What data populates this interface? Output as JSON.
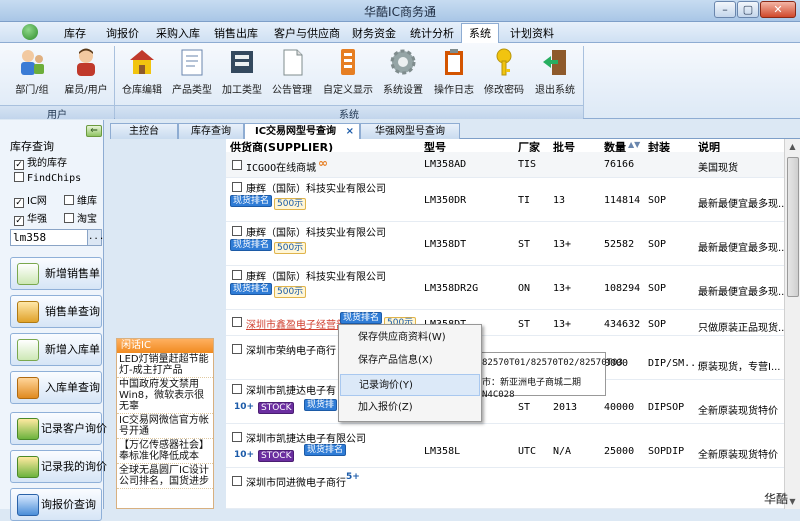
{
  "app": {
    "title": "华酷IC商务通"
  },
  "menu": {
    "items": [
      "库存",
      "询报价",
      "采购入库",
      "销售出库",
      "客户与供应商",
      "财务资金",
      "统计分析",
      "系统",
      "计划资料"
    ]
  },
  "ribbon": {
    "user_group": {
      "label": "用户",
      "buttons": [
        "部门/组",
        "雇员/用户"
      ]
    },
    "system_group": {
      "label": "系统",
      "buttons": [
        "仓库编辑",
        "产品类型",
        "加工类型",
        "公告管理",
        "自定义显示",
        "系统设置",
        "操作日志",
        "修改密码",
        "退出系统"
      ]
    }
  },
  "left_panel": {
    "title": "库存查询",
    "options": [
      {
        "label": "我的库存",
        "checked": true
      },
      {
        "label": "FindChips",
        "checked": false
      },
      {
        "label": "IC网",
        "checked": true
      },
      {
        "label": "维库",
        "checked": false
      },
      {
        "label": "华强",
        "checked": true
      },
      {
        "label": "淘宝",
        "checked": false
      }
    ],
    "search_value": "lm358",
    "search_btn": "...",
    "buttons": [
      "新增销售单",
      "销售单查询",
      "新增入库单",
      "入库单查询",
      "记录客户询价",
      "记录我的询价",
      "询报价查询"
    ]
  },
  "news": {
    "header": "闲话IC",
    "items": [
      "LED灯销量赶超节能灯-成主打产品",
      "中国政府发文禁用Win8，微软表示很无辜",
      "IC交易网微信官方帐号开通",
      "【万亿传感器社会】奉标准化降低成本",
      "全球无晶圆厂IC设计公司排名，国货进步"
    ]
  },
  "tabs": [
    "主控台",
    "库存查询",
    "IC交易网型号查询",
    "华强网型号查询"
  ],
  "tab_close": "×",
  "table": {
    "headers": [
      "供货商(SUPPLIER)",
      "型号",
      "厂家",
      "批号",
      "数量",
      "封装",
      "说明"
    ],
    "rows": [
      {
        "supplier": "ICGOO在线商城",
        "model": "LM358AD",
        "maker": "TIS",
        "batch": "",
        "qty": "76166",
        "pkg": "",
        "desc": "美国现货",
        "badges": []
      },
      {
        "supplier": "康辉（国际）科技实业有限公司",
        "model": "LM350DR",
        "maker": "TI",
        "batch": "13",
        "qty": "114814",
        "pkg": "SOP",
        "desc": "最新最便宜最多现...",
        "badges": [
          "现货排名",
          "500示"
        ]
      },
      {
        "supplier": "康辉（国际）科技实业有限公司",
        "model": "LM358DT",
        "maker": "ST",
        "batch": "13+",
        "qty": "52582",
        "pkg": "SOP",
        "desc": "最新最便宜最多现...",
        "badges": [
          "现货排名",
          "500示"
        ]
      },
      {
        "supplier": "康辉（国际）科技实业有限公司",
        "model": "LM358DR2G",
        "maker": "ON",
        "batch": "13+",
        "qty": "108294",
        "pkg": "SOP",
        "desc": "最新最便宜最多现...",
        "badges": [
          "现货排名",
          "500示"
        ]
      },
      {
        "supplier": "深圳市鑫盈电子经营部",
        "model": "LM358DT",
        "maker": "ST",
        "batch": "13+",
        "qty": "434632",
        "pkg": "SOP",
        "desc": "只做原装正品现货...",
        "badges": [
          "现货排名",
          "500示"
        ]
      },
      {
        "supplier": "深圳市荣纳电子商行",
        "model": "",
        "maker": "",
        "batch": "",
        "qty": "0000",
        "pkg": "DIP/SM...",
        "desc": "原装现货，专营I...",
        "badges": []
      },
      {
        "supplier": "深圳市凯捷达电子有",
        "model": "",
        "maker": "ST",
        "batch": "2013",
        "qty": "40000",
        "pkg": "DIPSOP",
        "desc": "全新原装现货特价",
        "badges": [
          "10+",
          "STOCK",
          "现货排"
        ]
      },
      {
        "supplier": "深圳市凯捷达电子有限公司",
        "model": "LM358L",
        "maker": "UTC",
        "batch": "N/A",
        "qty": "25000",
        "pkg": "SOPDIP",
        "desc": "全新原装现货特价",
        "badges": [
          "10+",
          "STOCK",
          "现货排名"
        ]
      },
      {
        "supplier": "深圳市同进微电子商行",
        "model": "",
        "maker": "",
        "batch": "",
        "qty": "",
        "pkg": "",
        "desc": "",
        "badges": [
          "5+"
        ]
      }
    ]
  },
  "tooltip": {
    "lines": [
      "82570T01/82570T02/82570T03",
      "市：新亚洲电子商城二期N4C028"
    ]
  },
  "context_menu": {
    "items": [
      "保存供应商资料(W)",
      "保存产品信息(X)",
      "记录询价(Y)",
      "加入报价(Z)"
    ],
    "highlighted": 2
  },
  "watermark": "华酷"
}
